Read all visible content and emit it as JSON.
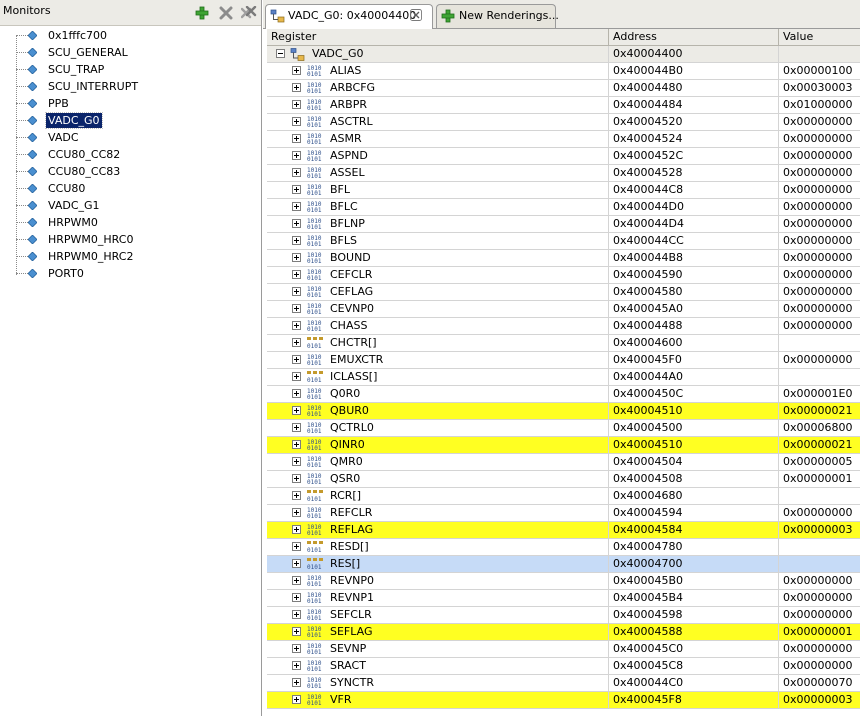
{
  "monitors": {
    "title": "Monitors",
    "items": [
      {
        "label": "0x1fffc700"
      },
      {
        "label": "SCU_GENERAL"
      },
      {
        "label": "SCU_TRAP"
      },
      {
        "label": "SCU_INTERRUPT"
      },
      {
        "label": "PPB"
      },
      {
        "label": "VADC_G0",
        "selected": true
      },
      {
        "label": "VADC"
      },
      {
        "label": "CCU80_CC82"
      },
      {
        "label": "CCU80_CC83"
      },
      {
        "label": "CCU80"
      },
      {
        "label": "VADC_G1"
      },
      {
        "label": "HRPWM0"
      },
      {
        "label": "HRPWM0_HRC0"
      },
      {
        "label": "HRPWM0_HRC2"
      },
      {
        "label": "PORT0"
      }
    ]
  },
  "tabs": [
    {
      "label": "VADC_G0: 0x40004400",
      "active": true
    },
    {
      "label": "New Renderings...",
      "active": false
    }
  ],
  "table": {
    "columns": {
      "register": "Register",
      "address": "Address",
      "value": "Value"
    },
    "group": {
      "name": "VADC_G0",
      "address": "0x40004400",
      "value": ""
    },
    "rows": [
      {
        "name": "ALIAS",
        "address": "0x400044B0",
        "value": "0x00000100",
        "kind": "reg",
        "state": ""
      },
      {
        "name": "ARBCFG",
        "address": "0x40004480",
        "value": "0x00030003",
        "kind": "reg",
        "state": ""
      },
      {
        "name": "ARBPR",
        "address": "0x40004484",
        "value": "0x01000000",
        "kind": "reg",
        "state": ""
      },
      {
        "name": "ASCTRL",
        "address": "0x40004520",
        "value": "0x00000000",
        "kind": "reg",
        "state": ""
      },
      {
        "name": "ASMR",
        "address": "0x40004524",
        "value": "0x00000000",
        "kind": "reg",
        "state": ""
      },
      {
        "name": "ASPND",
        "address": "0x4000452C",
        "value": "0x00000000",
        "kind": "reg",
        "state": ""
      },
      {
        "name": "ASSEL",
        "address": "0x40004528",
        "value": "0x00000000",
        "kind": "reg",
        "state": ""
      },
      {
        "name": "BFL",
        "address": "0x400044C8",
        "value": "0x00000000",
        "kind": "reg",
        "state": ""
      },
      {
        "name": "BFLC",
        "address": "0x400044D0",
        "value": "0x00000000",
        "kind": "reg",
        "state": ""
      },
      {
        "name": "BFLNP",
        "address": "0x400044D4",
        "value": "0x00000000",
        "kind": "reg",
        "state": ""
      },
      {
        "name": "BFLS",
        "address": "0x400044CC",
        "value": "0x00000000",
        "kind": "reg",
        "state": ""
      },
      {
        "name": "BOUND",
        "address": "0x400044B8",
        "value": "0x00000000",
        "kind": "reg",
        "state": ""
      },
      {
        "name": "CEFCLR",
        "address": "0x40004590",
        "value": "0x00000000",
        "kind": "reg",
        "state": ""
      },
      {
        "name": "CEFLAG",
        "address": "0x40004580",
        "value": "0x00000000",
        "kind": "reg",
        "state": ""
      },
      {
        "name": "CEVNP0",
        "address": "0x400045A0",
        "value": "0x00000000",
        "kind": "reg",
        "state": ""
      },
      {
        "name": "CHASS",
        "address": "0x40004488",
        "value": "0x00000000",
        "kind": "reg",
        "state": ""
      },
      {
        "name": "CHCTR[]",
        "address": "0x40004600",
        "value": "",
        "kind": "array",
        "state": ""
      },
      {
        "name": "EMUXCTR",
        "address": "0x400045F0",
        "value": "0x00000000",
        "kind": "reg",
        "state": ""
      },
      {
        "name": "ICLASS[]",
        "address": "0x400044A0",
        "value": "",
        "kind": "array",
        "state": ""
      },
      {
        "name": "Q0R0",
        "address": "0x4000450C",
        "value": "0x000001E0",
        "kind": "reg",
        "state": ""
      },
      {
        "name": "QBUR0",
        "address": "0x40004510",
        "value": "0x00000021",
        "kind": "reg",
        "state": "highlight"
      },
      {
        "name": "QCTRL0",
        "address": "0x40004500",
        "value": "0x00006800",
        "kind": "reg",
        "state": ""
      },
      {
        "name": "QINR0",
        "address": "0x40004510",
        "value": "0x00000021",
        "kind": "reg",
        "state": "highlight"
      },
      {
        "name": "QMR0",
        "address": "0x40004504",
        "value": "0x00000005",
        "kind": "reg",
        "state": ""
      },
      {
        "name": "QSR0",
        "address": "0x40004508",
        "value": "0x00000001",
        "kind": "reg",
        "state": ""
      },
      {
        "name": "RCR[]",
        "address": "0x40004680",
        "value": "",
        "kind": "array",
        "state": ""
      },
      {
        "name": "REFCLR",
        "address": "0x40004594",
        "value": "0x00000000",
        "kind": "reg",
        "state": ""
      },
      {
        "name": "REFLAG",
        "address": "0x40004584",
        "value": "0x00000003",
        "kind": "reg",
        "state": "highlight"
      },
      {
        "name": "RESD[]",
        "address": "0x40004780",
        "value": "",
        "kind": "array",
        "state": ""
      },
      {
        "name": "RES[]",
        "address": "0x40004700",
        "value": "",
        "kind": "array",
        "state": "selected"
      },
      {
        "name": "REVNP0",
        "address": "0x400045B0",
        "value": "0x00000000",
        "kind": "reg",
        "state": ""
      },
      {
        "name": "REVNP1",
        "address": "0x400045B4",
        "value": "0x00000000",
        "kind": "reg",
        "state": ""
      },
      {
        "name": "SEFCLR",
        "address": "0x40004598",
        "value": "0x00000000",
        "kind": "reg",
        "state": ""
      },
      {
        "name": "SEFLAG",
        "address": "0x40004588",
        "value": "0x00000001",
        "kind": "reg",
        "state": "highlight"
      },
      {
        "name": "SEVNP",
        "address": "0x400045C0",
        "value": "0x00000000",
        "kind": "reg",
        "state": ""
      },
      {
        "name": "SRACT",
        "address": "0x400045C8",
        "value": "0x00000000",
        "kind": "reg",
        "state": ""
      },
      {
        "name": "SYNCTR",
        "address": "0x400044C0",
        "value": "0x00000070",
        "kind": "reg",
        "state": ""
      },
      {
        "name": "VFR",
        "address": "0x400045F8",
        "value": "0x00000003",
        "kind": "reg",
        "state": "highlight"
      }
    ]
  },
  "icons": {
    "monitor_item": "diamond-icon",
    "register": "binary-register-icon",
    "array": "array-register-icon",
    "group": "register-group-icon",
    "add": "add-icon",
    "remove": "remove-icon",
    "remove_all": "remove-all-icon"
  },
  "colors": {
    "highlight": "#ffff22",
    "selected_row": "#c6dbf7",
    "selected_monitor": "#0a246a",
    "chrome": "#ecebe6"
  }
}
